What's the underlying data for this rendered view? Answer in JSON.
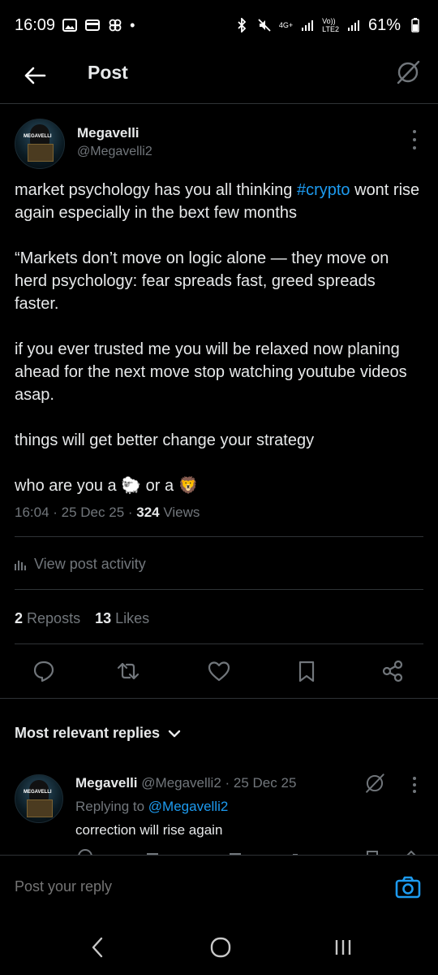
{
  "status": {
    "time": "16:09",
    "battery": "61%",
    "network_top": "4G+",
    "volte": "Vo))",
    "lte": "LTE2"
  },
  "header": {
    "title": "Post"
  },
  "post": {
    "author_name": "Megavelli",
    "author_handle": "@Megavelli2",
    "avatar_text": "MEGAVELLI",
    "body_part1": "market psychology has you all thinking ",
    "hashtag": "#crypto",
    "body_part2": " wont rise again especially in the bext few months\n\n“Markets don’t move on logic alone — they move on herd psychology: fear spreads fast, greed spreads faster.\n\nif you ever trusted me you will be relaxed now planing ahead for the next move stop watching youtube videos asap.\n\nthings will get better change your strategy\n\nwho are you a 🐑 or a 🦁",
    "timestamp": "16:04 · 25 Dec 25 · ",
    "views_count": "324",
    "views_label": " Views",
    "activity_label": "View post activity",
    "reposts_count": "2",
    "reposts_label": "Reposts",
    "likes_count": "13",
    "likes_label": "Likes"
  },
  "replies": {
    "heading": "Most relevant replies",
    "items": [
      {
        "name": "Megavelli",
        "handle": " @Megavelli2 · 25 Dec 25",
        "replying_prefix": "Replying to ",
        "replying_to": "@Megavelli2",
        "text": "correction will rise again"
      }
    ]
  },
  "compose": {
    "placeholder": "Post your reply"
  },
  "colors": {
    "accent": "#1d9bf0",
    "muted": "#71767b",
    "text": "#e7e9ea",
    "border": "#2f3336"
  },
  "icons": [
    "back-arrow-icon",
    "grok-icon",
    "more-icon",
    "analytics-icon",
    "reply-icon",
    "repost-icon",
    "like-icon",
    "bookmark-icon",
    "share-icon",
    "chevron-down-icon",
    "camera-icon",
    "nav-back-icon",
    "nav-home-icon",
    "nav-recents-icon"
  ]
}
